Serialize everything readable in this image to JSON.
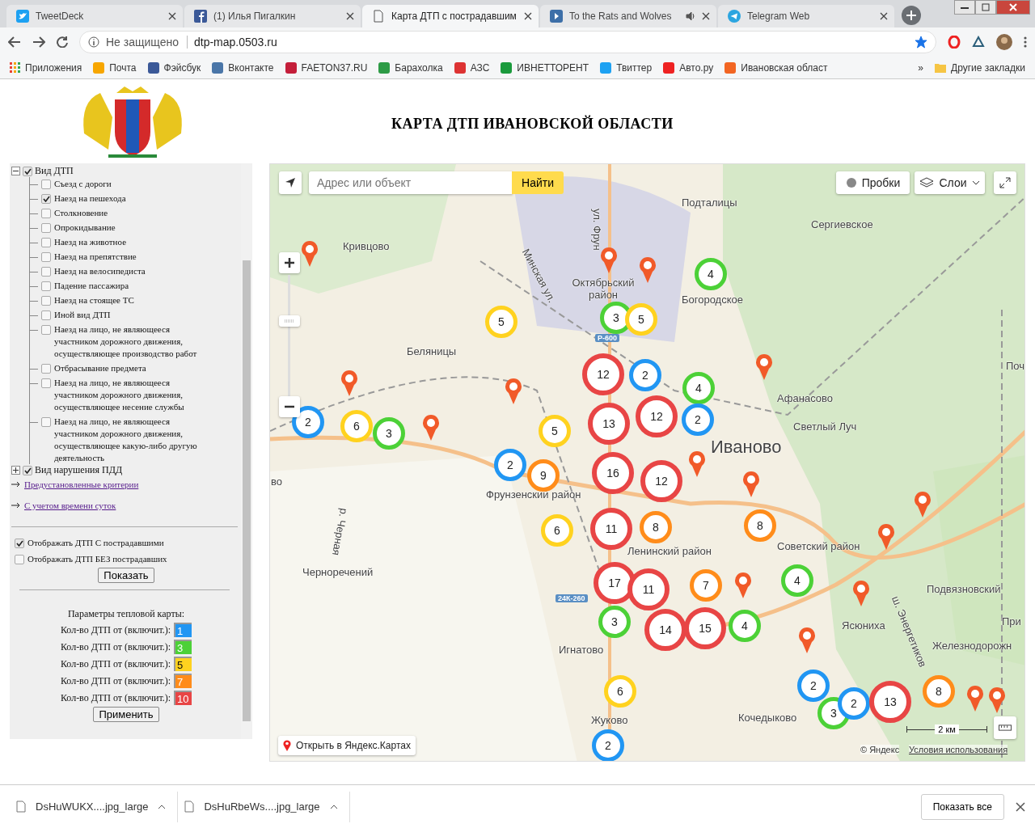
{
  "browser": {
    "tabs": [
      {
        "title": "TweetDeck",
        "kind": "twitter",
        "selected": false,
        "audio": false
      },
      {
        "title": "(1) Илья Пигалкин",
        "kind": "facebook",
        "selected": false,
        "audio": false
      },
      {
        "title": "Карта ДТП с пострадавшим",
        "kind": "page",
        "selected": true,
        "audio": false
      },
      {
        "title": "To the Rats and Wolves",
        "kind": "video",
        "selected": false,
        "audio": true
      },
      {
        "title": "Telegram Web",
        "kind": "telegram",
        "selected": false,
        "audio": false
      }
    ],
    "address": {
      "security": "Не защищено",
      "url": "dtp-map.0503.ru",
      "bookmarked": true
    },
    "bookmarks": [
      {
        "label": "Приложения"
      },
      {
        "label": "Почта"
      },
      {
        "label": "Фэйсбук"
      },
      {
        "label": "Вконтакте"
      },
      {
        "label": "FAETON37.RU"
      },
      {
        "label": "Барахолка"
      },
      {
        "label": "АЗС"
      },
      {
        "label": "ИВНЕТТОРЕНТ"
      },
      {
        "label": "Твиттер"
      },
      {
        "label": "Авто.ру"
      },
      {
        "label": "Ивановская област"
      }
    ],
    "more_bookmarks": "»",
    "other_bookmarks": "Другие закладки"
  },
  "page": {
    "title": "КАРТА ДТП ИВАНОВСКОЙ ОБЛАСТИ",
    "tree": [
      {
        "label": "Вид ДТП",
        "checked": true,
        "expanded": true,
        "children": [
          {
            "label": "Съезд с дороги",
            "checked": false
          },
          {
            "label": "Наезд на пешехода",
            "checked": true
          },
          {
            "label": "Столкновение",
            "checked": false
          },
          {
            "label": "Опрокидывание",
            "checked": false
          },
          {
            "label": "Наезд на животное",
            "checked": false
          },
          {
            "label": "Наезд на препятствие",
            "checked": false
          },
          {
            "label": "Наезд на велосипедиста",
            "checked": false
          },
          {
            "label": "Падение пассажира",
            "checked": false
          },
          {
            "label": "Наезд на стоящее ТС",
            "checked": false
          },
          {
            "label": "Иной вид ДТП",
            "checked": false
          },
          {
            "label": "Наезд на лицо, не являющееся участником дорожного движения, осуществляющее производство работ",
            "checked": false
          },
          {
            "label": "Отбрасывание предмета",
            "checked": false
          },
          {
            "label": "Наезд на лицо, не являющееся участником дорожного движения, осуществляющее несение службы",
            "checked": false
          },
          {
            "label": "Наезд на лицо, не являющееся участником дорожного движения, осуществляющее какую-либо другую деятельность",
            "checked": false
          }
        ]
      },
      {
        "label": "Вид нарушения ПДД",
        "checked": true,
        "expanded": false
      }
    ],
    "links": [
      "Предустановленные критерии",
      "С учетом времени суток"
    ],
    "options": [
      {
        "label": "Отображать ДТП С пострадавшими",
        "checked": true
      },
      {
        "label": "Отображать ДТП БЕЗ пострадавших",
        "checked": false
      }
    ],
    "show_button": "Показать",
    "heatmap": {
      "title": "Параметры тепловой карты:",
      "rows": [
        {
          "label": "Кол-во ДТП от (включит.):",
          "value": "1",
          "color": "#2196f3"
        },
        {
          "label": "Кол-во ДТП от (включит.):",
          "value": "3",
          "color": "#4cd137"
        },
        {
          "label": "Кол-во ДТП от (включит.):",
          "value": "5",
          "color": "#ffd21f"
        },
        {
          "label": "Кол-во ДТП от (включит.):",
          "value": "7",
          "color": "#ff8c1a"
        },
        {
          "label": "Кол-во ДТП от (включит.):",
          "value": "10",
          "color": "#e84545"
        }
      ],
      "apply_button": "Применить"
    }
  },
  "map": {
    "search_placeholder": "Адрес или объект",
    "search_button": "Найти",
    "traffic_button": "Пробки",
    "layers_button": "Слои",
    "labels": [
      "Подталицы",
      "Сергиевское",
      "Кривцово",
      "Богородское",
      "Октябрьский район",
      "Беляницы",
      "Афанасово",
      "Светлый Луч",
      "Поч",
      "Иваново",
      "во",
      "Фрунзенский район",
      "Советский район",
      "Ленинский район",
      "Черноречений",
      "Подвязновский",
      "Ясюниха",
      "Игнатово",
      "Железнодорожн",
      "При",
      "Кочедыково",
      "Жуково",
      "Минская ул.",
      "ул. Фрун",
      "р. Черная",
      "ш. Энергетиков"
    ],
    "road_badges": [
      "Р-600",
      "24К-260"
    ],
    "clusters": [
      {
        "count": "4",
        "color": "#4cd137"
      },
      {
        "count": "5",
        "color": "#ffd21f"
      },
      {
        "count": "3",
        "color": "#4cd137"
      },
      {
        "count": "5",
        "color": "#ffd21f"
      },
      {
        "count": "12",
        "color": "#e84545"
      },
      {
        "count": "2",
        "color": "#2196f3"
      },
      {
        "count": "4",
        "color": "#4cd137"
      },
      {
        "count": "2",
        "color": "#2196f3"
      },
      {
        "count": "6",
        "color": "#ffd21f"
      },
      {
        "count": "3",
        "color": "#4cd137"
      },
      {
        "count": "5",
        "color": "#ffd21f"
      },
      {
        "count": "13",
        "color": "#e84545"
      },
      {
        "count": "12",
        "color": "#e84545"
      },
      {
        "count": "2",
        "color": "#2196f3"
      },
      {
        "count": "2",
        "color": "#2196f3"
      },
      {
        "count": "9",
        "color": "#ff8c1a"
      },
      {
        "count": "16",
        "color": "#e84545"
      },
      {
        "count": "12",
        "color": "#e84545"
      },
      {
        "count": "6",
        "color": "#ffd21f"
      },
      {
        "count": "11",
        "color": "#e84545"
      },
      {
        "count": "8",
        "color": "#ff8c1a"
      },
      {
        "count": "8",
        "color": "#ff8c1a"
      },
      {
        "count": "17",
        "color": "#e84545"
      },
      {
        "count": "11",
        "color": "#e84545"
      },
      {
        "count": "7",
        "color": "#ff8c1a"
      },
      {
        "count": "4",
        "color": "#4cd137"
      },
      {
        "count": "3",
        "color": "#4cd137"
      },
      {
        "count": "14",
        "color": "#e84545"
      },
      {
        "count": "15",
        "color": "#e84545"
      },
      {
        "count": "4",
        "color": "#4cd137"
      },
      {
        "count": "6",
        "color": "#ffd21f"
      },
      {
        "count": "2",
        "color": "#2196f3"
      },
      {
        "count": "3",
        "color": "#4cd137"
      },
      {
        "count": "2",
        "color": "#2196f3"
      },
      {
        "count": "13",
        "color": "#e84545"
      },
      {
        "count": "8",
        "color": "#ff8c1a"
      },
      {
        "count": "2",
        "color": "#2196f3"
      }
    ],
    "open_link": "Открыть в Яндекс.Картах",
    "scale": "2 км",
    "copyright": "© Яндекс",
    "terms": "Условия использования"
  },
  "downloads": {
    "items": [
      "DsHuWUKX....jpg_large",
      "DsHuRbeWs....jpg_large"
    ],
    "show_all": "Показать все"
  }
}
